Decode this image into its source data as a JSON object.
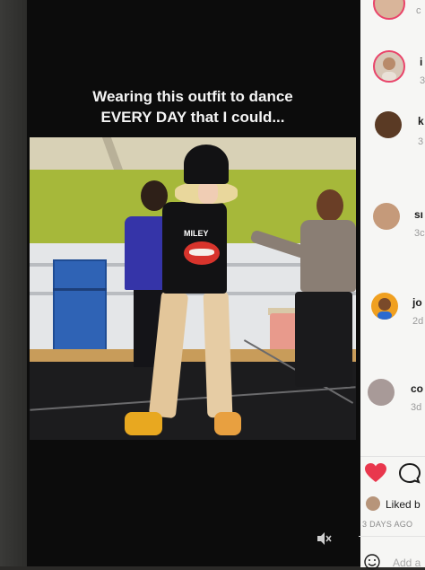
{
  "video": {
    "caption_line1": "Wearing this outfit to dance",
    "caption_line2": "EVERY DAY that I could...",
    "shirt_text": "MILEY",
    "mute_icon": "speaker-muted-icon"
  },
  "comments": [
    {
      "name": "",
      "time": "c",
      "avatar_icon": "avatar-ring"
    },
    {
      "name": "i",
      "time": "3",
      "avatar_icon": "avatar-ring"
    },
    {
      "name": "k",
      "time": "3",
      "avatar_icon": "avatar"
    },
    {
      "name": "sı",
      "time": "3c",
      "avatar_icon": "avatar"
    },
    {
      "name": "jo",
      "time": "2d",
      "avatar_icon": "avatar"
    },
    {
      "name": "co",
      "time": "3d",
      "avatar_icon": "avatar"
    }
  ],
  "actions": {
    "like_icon": "heart-icon",
    "comment_icon": "comment-bubble-icon",
    "liked_by": "Liked b",
    "posted_ago": "3 DAYS AGO",
    "add_comment_placeholder": "Add a",
    "emoji_icon": "emoji-icon"
  },
  "colors": {
    "like": "#e9374d",
    "story_ring": "#e9446a",
    "sidebar_bg": "#f6f6f4"
  }
}
